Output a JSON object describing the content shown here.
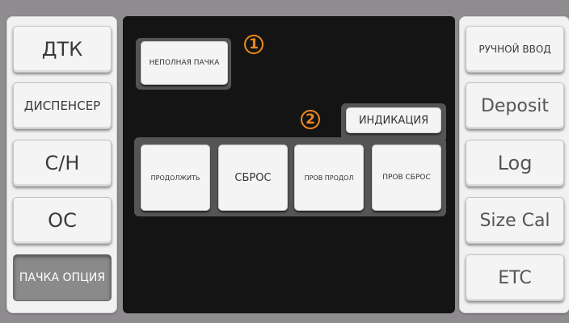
{
  "left_menu": {
    "items": [
      {
        "label": "ДТК",
        "selected": false
      },
      {
        "label": "ДИСПЕНСЕР",
        "selected": false
      },
      {
        "label": "С/Н",
        "selected": false
      },
      {
        "label": "ОС",
        "selected": false
      },
      {
        "label": "ПАЧКА ОПЦИЯ",
        "selected": true
      }
    ]
  },
  "right_menu": {
    "items": [
      {
        "label": "РУЧНОЙ ВВОД"
      },
      {
        "label": "Deposit"
      },
      {
        "label": "Log"
      },
      {
        "label": "Size Cal"
      },
      {
        "label": "ETC"
      }
    ]
  },
  "main": {
    "incomplete_pack_label": "НЕПОЛНАЯ ПАЧКА",
    "indication_tab_label": "ИНДИКАЦИЯ",
    "actions": [
      {
        "label": "ПРОДОЛЖИТЬ"
      },
      {
        "label": "СБРОС"
      },
      {
        "label": "ПРОВ ПРОДОЛ"
      },
      {
        "label": "ПРОВ СБРОС"
      }
    ]
  },
  "markers": [
    "1",
    "2"
  ],
  "colors": {
    "marker": "#ef8a1c",
    "screen": "#141414",
    "selected_button": "#8a8a8a"
  }
}
